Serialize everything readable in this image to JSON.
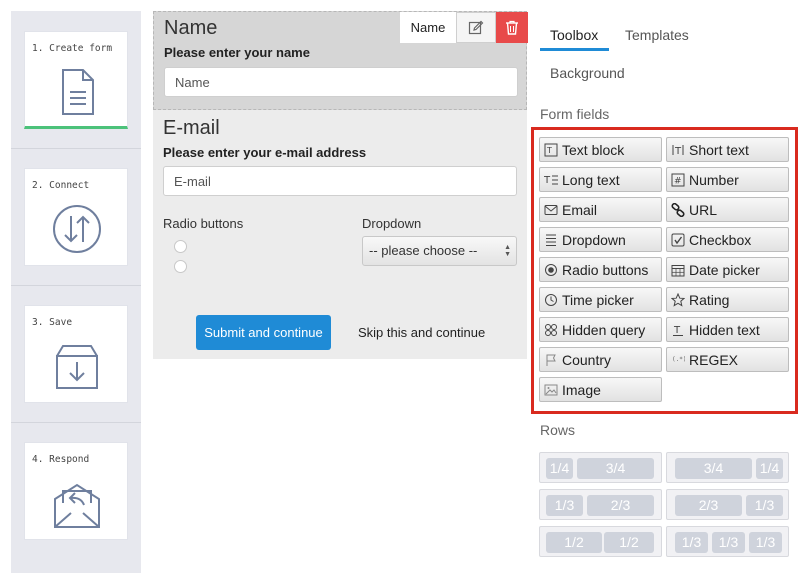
{
  "steps": [
    {
      "label": "1. Create form",
      "icon": "document-icon",
      "active": true
    },
    {
      "label": "2. Connect",
      "icon": "sync-arrows-icon"
    },
    {
      "label": "3. Save",
      "icon": "archive-down-icon"
    },
    {
      "label": "4. Respond",
      "icon": "envelope-reply-icon"
    }
  ],
  "form": {
    "name_field": {
      "title": "Name",
      "label": "Please enter your name",
      "placeholder": "Name",
      "tag": "Name"
    },
    "email_field": {
      "title": "E-mail",
      "label": "Please enter your e-mail address",
      "placeholder": "E-mail"
    },
    "radio_label": "Radio buttons",
    "dropdown_label": "Dropdown",
    "dropdown_value": "-- please choose --",
    "submit_label": "Submit and continue",
    "skip_label": "Skip this and continue"
  },
  "tabs": {
    "toolbox": "Toolbox",
    "templates": "Templates",
    "background": "Background"
  },
  "sections": {
    "form_fields": "Form fields",
    "rows": "Rows"
  },
  "fields": [
    {
      "label": "Text block",
      "icon": "text-block-icon"
    },
    {
      "label": "Short text",
      "icon": "short-text-icon"
    },
    {
      "label": "Long text",
      "icon": "long-text-icon"
    },
    {
      "label": "Number",
      "icon": "number-icon"
    },
    {
      "label": "Email",
      "icon": "envelope-icon"
    },
    {
      "label": "URL",
      "icon": "link-icon"
    },
    {
      "label": "Dropdown",
      "icon": "list-icon"
    },
    {
      "label": "Checkbox",
      "icon": "checkbox-icon"
    },
    {
      "label": "Radio buttons",
      "icon": "radio-icon"
    },
    {
      "label": "Date picker",
      "icon": "calendar-icon"
    },
    {
      "label": "Time picker",
      "icon": "clock-icon"
    },
    {
      "label": "Rating",
      "icon": "star-icon"
    },
    {
      "label": "Hidden query",
      "icon": "hidden-query-icon"
    },
    {
      "label": "Hidden text",
      "icon": "hidden-text-icon"
    },
    {
      "label": "Country",
      "icon": "flag-icon"
    },
    {
      "label": "REGEX",
      "icon": "regex-icon"
    },
    {
      "label": "Image",
      "icon": "image-icon"
    }
  ],
  "rows": [
    [
      "1/4",
      "3/4"
    ],
    [
      "3/4",
      "1/4"
    ],
    [
      "1/3",
      "2/3"
    ],
    [
      "2/3",
      "1/3"
    ],
    [
      "1/2",
      "1/2"
    ],
    [
      "1/3",
      "1/3",
      "1/3"
    ]
  ],
  "colors": {
    "accent": "#1f8bd6",
    "highlight": "#d92a1f",
    "delete": "#e84a4a",
    "active_step": "#4cc27a"
  }
}
